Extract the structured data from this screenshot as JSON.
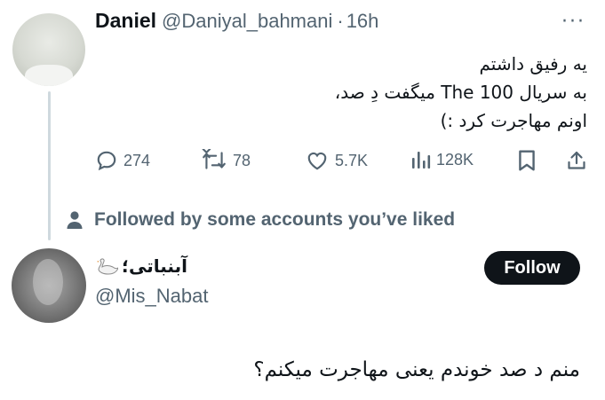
{
  "tweet": {
    "author_name": "Daniel",
    "author_handle": "@Daniyal_bahmani",
    "separator": "·",
    "time": "16h",
    "more_label": "···",
    "text_lines": [
      "یه رفیق داشتم",
      "به سریال The 100 میگفت دِ صد،",
      "اونم مهاجرت کرد :)"
    ],
    "actions": {
      "replies": "274",
      "reposts": "78",
      "likes": "5.7K",
      "views": "128K"
    }
  },
  "social_context": "Followed by some accounts you’ve liked",
  "suggested_user": {
    "name": "آبنباتی؛",
    "handle": "@Mis_Nabat",
    "follow_label": "Follow"
  },
  "reply": {
    "text": "منم د صد خوندم یعنی مهاجرت میکنم؟"
  },
  "colors": {
    "primary_text": "#0f1419",
    "secondary_text": "#536471",
    "thread_line": "#cfd9de",
    "follow_bg": "#0f1419"
  }
}
